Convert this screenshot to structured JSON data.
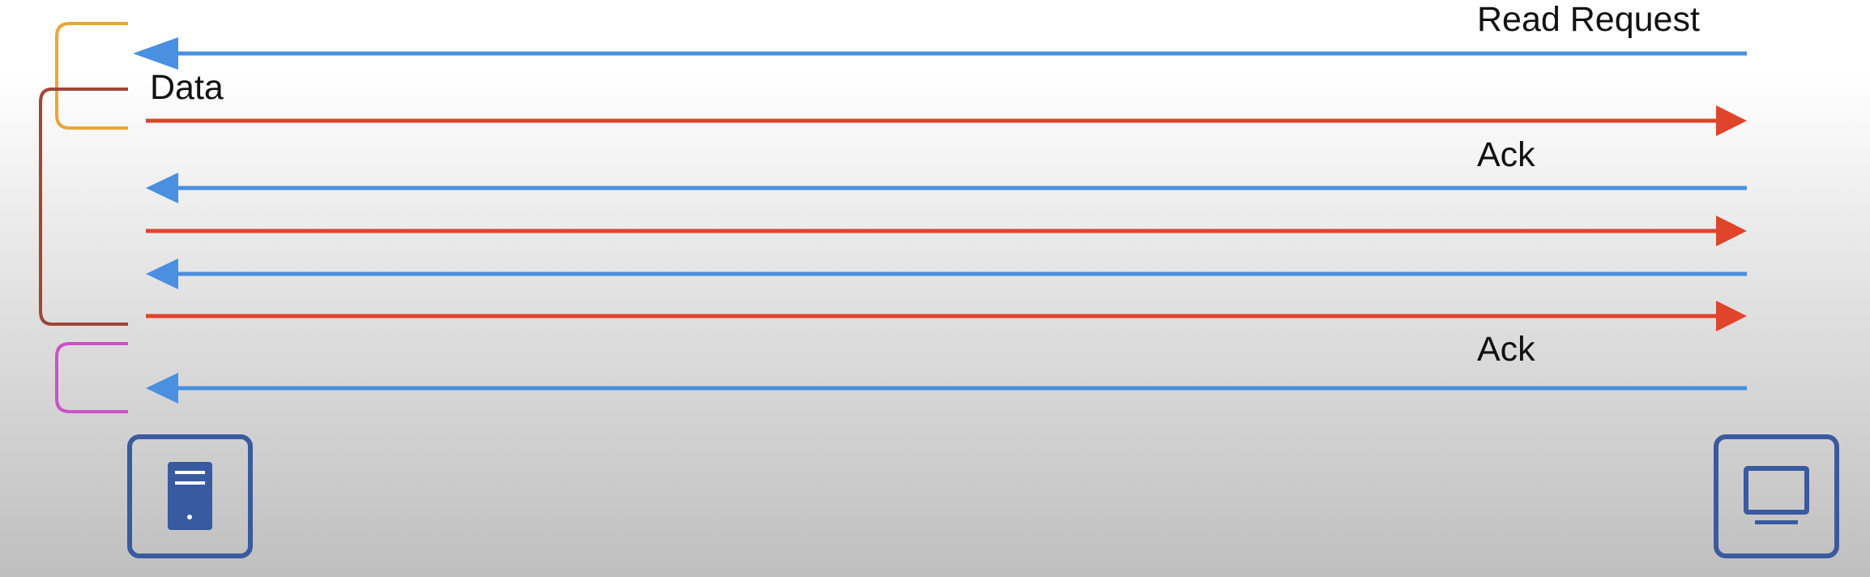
{
  "labels": {
    "read_request": "Read Request",
    "data": "Data",
    "ack_first": "Ack",
    "ack_second": "Ack"
  },
  "colors": {
    "request_arrow": "#4a8fe0",
    "data_arrow": "#e0442a",
    "bracket_request": "#eaa53a",
    "bracket_data": "#a0463a",
    "bracket_final_ack": "#c953c9",
    "device": "#3a5aa0"
  },
  "icons": {
    "server": "server-icon",
    "client": "computer-monitor-icon"
  },
  "messages": [
    {
      "direction": "to-server",
      "kind": "request"
    },
    {
      "direction": "to-client",
      "kind": "data"
    },
    {
      "direction": "to-server",
      "kind": "ack"
    },
    {
      "direction": "to-client",
      "kind": "data"
    },
    {
      "direction": "to-server",
      "kind": "ack"
    },
    {
      "direction": "to-client",
      "kind": "data"
    },
    {
      "direction": "to-server",
      "kind": "ack"
    }
  ]
}
